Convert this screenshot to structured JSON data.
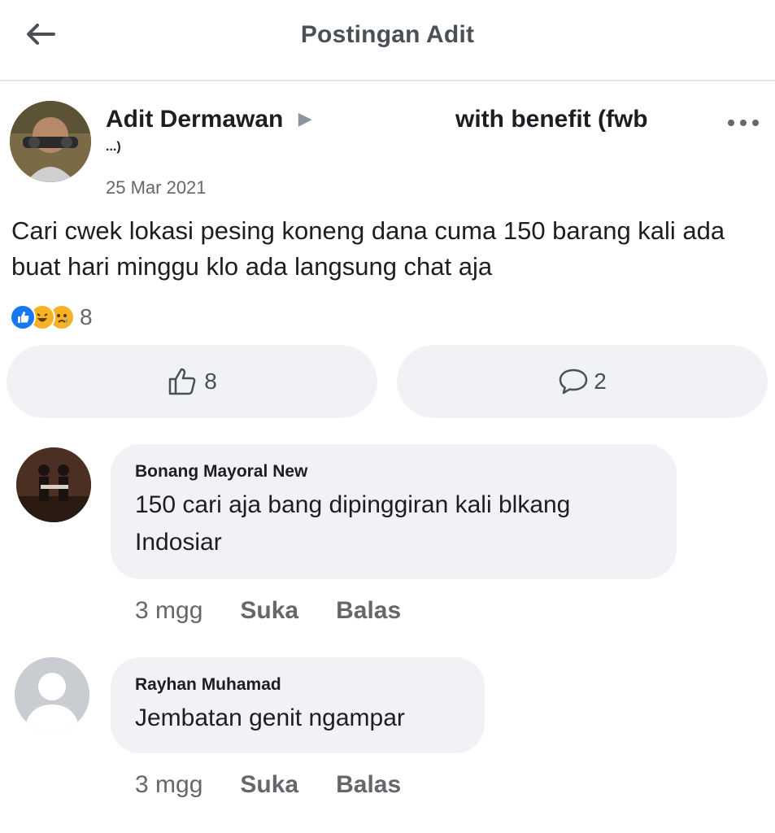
{
  "header": {
    "title": "Postingan Adit"
  },
  "post": {
    "author": "Adit Dermawan",
    "group_partial": "with benefit (fwb",
    "group_cont": "...)",
    "date": "25 Mar 2021",
    "body": "Cari cwek lokasi pesing koneng dana cuma 150 barang kali ada buat hari minggu klo ada langsung chat aja",
    "reaction_count": "8",
    "like_count": "8",
    "comment_count": "2"
  },
  "comments": [
    {
      "name": "Bonang Mayoral New",
      "text": "150 cari aja bang dipinggiran kali blkang Indosiar",
      "time": "3 mgg",
      "like": "Suka",
      "reply": "Balas"
    },
    {
      "name": "Rayhan Muhamad",
      "text": "Jembatan genit ngampar",
      "time": "3 mgg",
      "like": "Suka",
      "reply": "Balas"
    }
  ],
  "colors": {
    "like_blue": "#1877f2",
    "haha_yellow": "#f7b125",
    "muted": "#65676b",
    "bubble_bg": "#f0f2f5"
  }
}
